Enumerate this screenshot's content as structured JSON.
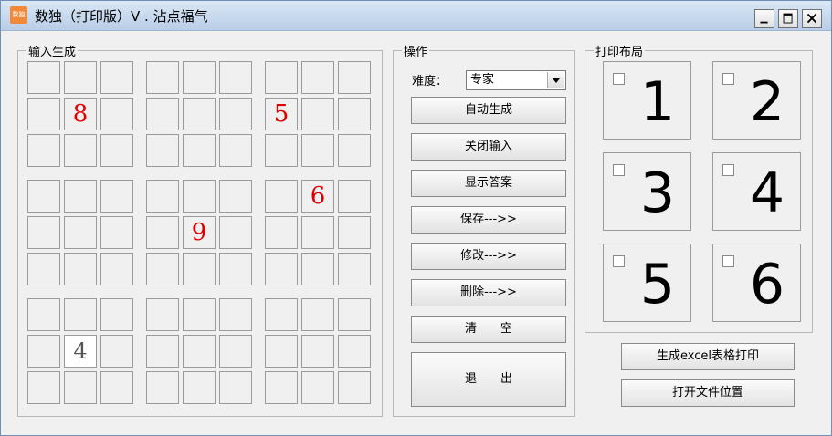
{
  "window": {
    "title": "数独（打印版）V . 沾点福气",
    "icon_text": "数独",
    "min_icon": "minimize-icon",
    "max_icon": "maximize-icon",
    "close_icon": "close-icon"
  },
  "input_group": {
    "label": "输入生成",
    "cells": [
      [
        "",
        "",
        "",
        "",
        "",
        "",
        "",
        "",
        ""
      ],
      [
        "",
        "8",
        "",
        "",
        "",
        "",
        "5",
        "",
        ""
      ],
      [
        "",
        "",
        "",
        "",
        "",
        "",
        "",
        "",
        ""
      ],
      [
        "",
        "",
        "",
        "",
        "",
        "",
        "",
        "6",
        ""
      ],
      [
        "",
        "",
        "",
        "",
        "9",
        "",
        "",
        "",
        ""
      ],
      [
        "",
        "",
        "",
        "",
        "",
        "",
        "",
        "",
        ""
      ],
      [
        "",
        "",
        "",
        "",
        "",
        "",
        "",
        "",
        ""
      ],
      [
        "",
        "4",
        "",
        "",
        "",
        "",
        "",
        "",
        ""
      ],
      [
        "",
        "",
        "",
        "",
        "",
        "",
        "",
        "",
        ""
      ]
    ]
  },
  "ops": {
    "label": "操作",
    "difficulty_label": "难度：",
    "difficulty_value": "专家",
    "buttons": [
      "自动生成",
      "关闭输入",
      "显示答案",
      "保存--->>",
      "修改--->>",
      "删除--->>",
      "清　　空"
    ],
    "exit": "退　　出"
  },
  "layout": {
    "label": "打印布局",
    "options": [
      "1",
      "2",
      "3",
      "4",
      "5",
      "6"
    ]
  },
  "bottom": {
    "excel_button": "生成excel表格打印",
    "open_folder_button": "打开文件位置"
  }
}
